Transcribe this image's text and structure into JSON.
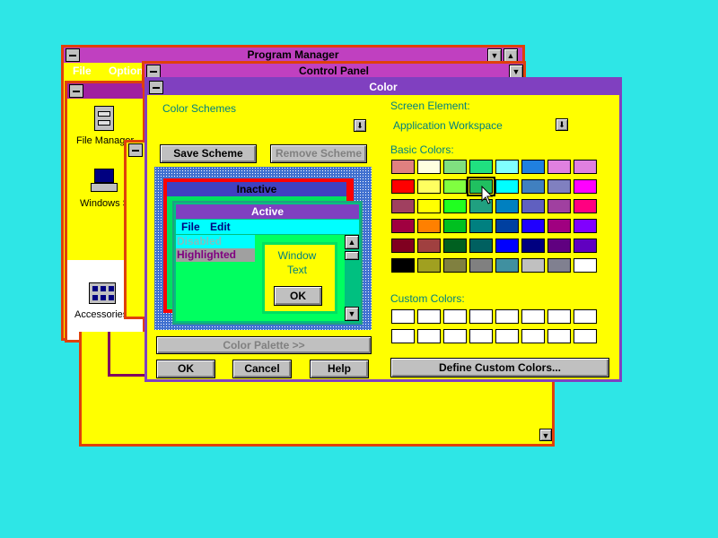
{
  "program_manager": {
    "title": "Program Manager",
    "menu": [
      "File",
      "Options"
    ],
    "icons": [
      {
        "label": "File Manager"
      },
      {
        "label": "Windows Setup"
      },
      {
        "label": "Accessories"
      }
    ]
  },
  "control_panel": {
    "title": "Control Panel"
  },
  "color_dialog": {
    "title": "Color",
    "color_schemes_label": "Color Schemes",
    "color_schemes_value": "",
    "save_scheme": "Save Scheme",
    "remove_scheme": "Remove Scheme",
    "preview": {
      "inactive_title": "Inactive",
      "active_title": "Active",
      "menu": [
        "File",
        "Edit"
      ],
      "disabled": "Disabled",
      "highlighted": "Highlighted",
      "window_text": "Window Text",
      "ok": "OK"
    },
    "color_palette": "Color Palette >>",
    "ok": "OK",
    "cancel": "Cancel",
    "help": "Help",
    "screen_element_label": "Screen Element:",
    "screen_element_value": "Application Workspace",
    "basic_colors_label": "Basic Colors:",
    "custom_colors_label": "Custom Colors:",
    "define_custom": "Define Custom Colors...",
    "selected_basic_color": "#20c060",
    "basic_colors": [
      [
        "#e08080",
        "#ffffe0",
        "#80e080",
        "#20e080",
        "#80ffff",
        "#2080e0",
        "#e080e0",
        "#e080e0"
      ],
      [
        "#ff0000",
        "#ffff60",
        "#80ff40",
        "#00e060",
        "#00ffff",
        "#4080c0",
        "#8080c0",
        "#ff00ff"
      ],
      [
        "#a04060",
        "#ffff00",
        "#20ff20",
        "#20a080",
        "#0080c0",
        "#6060c0",
        "#a040a0",
        "#ff0080"
      ],
      [
        "#a00040",
        "#ff8000",
        "#00c020",
        "#008080",
        "#0040a0",
        "#2000ff",
        "#a00080",
        "#8000ff"
      ],
      [
        "#800020",
        "#a04040",
        "#006020",
        "#006060",
        "#0000ff",
        "#000080",
        "#600080",
        "#6000c0"
      ],
      [
        "#000000",
        "#a0a020",
        "#808040",
        "#808080",
        "#4090a0",
        "#c0c0c0",
        "#808090",
        "#ffffff"
      ]
    ]
  }
}
